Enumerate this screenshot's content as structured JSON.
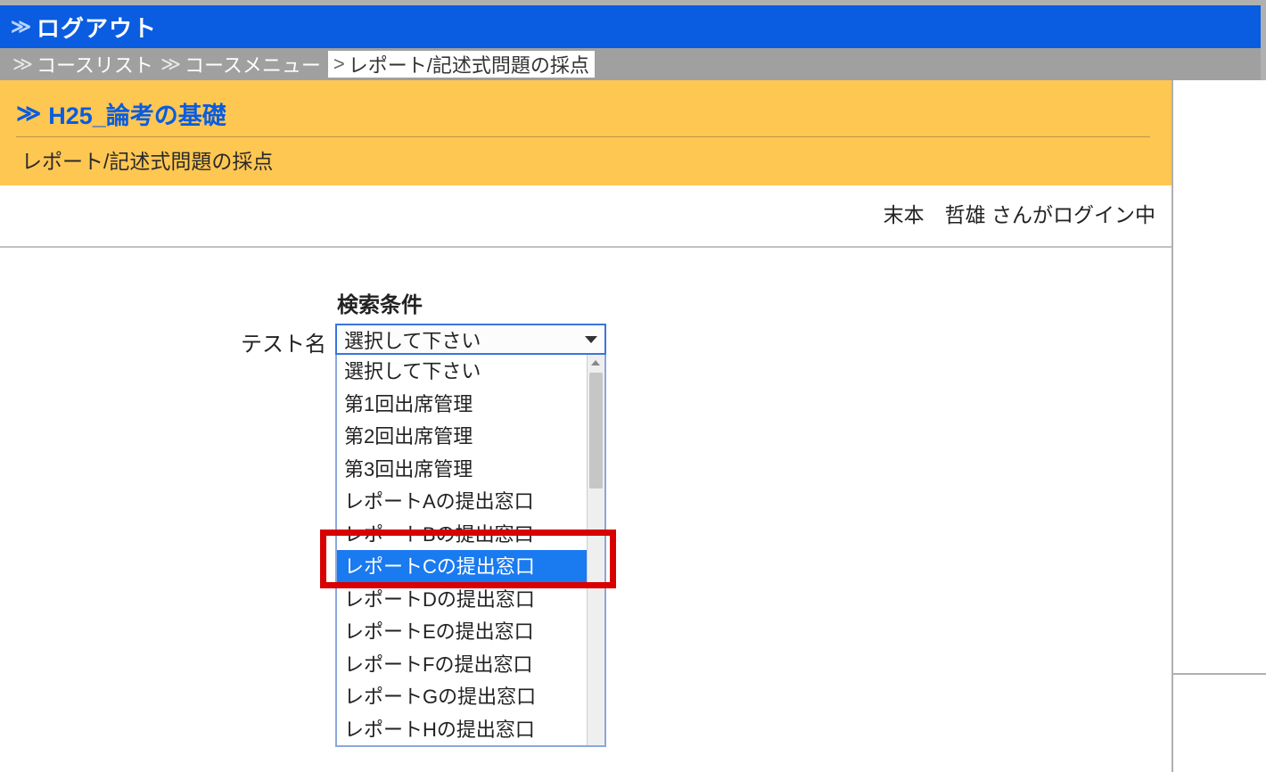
{
  "topbar": {
    "logout_label": "ログアウト"
  },
  "breadcrumb": {
    "items": [
      {
        "label": "コースリスト",
        "sep": "≫",
        "active": false
      },
      {
        "label": "コースメニュー",
        "sep": "≫",
        "active": false
      },
      {
        "label": "レポート/記述式問題の採点",
        "sep": ">",
        "active": true
      }
    ]
  },
  "course": {
    "title": "H25_論考の基礎",
    "subtitle": "レポート/記述式問題の採点"
  },
  "login_status": "末本　哲雄 さんがログイン中",
  "search": {
    "heading": "検索条件",
    "label": "テスト名",
    "selected": "選択して下さい",
    "options": [
      "選択して下さい",
      "第1回出席管理",
      "第2回出席管理",
      "第3回出席管理",
      "レポートAの提出窓口",
      "レポートBの提出窓口",
      "レポートCの提出窓口",
      "レポートDの提出窓口",
      "レポートEの提出窓口",
      "レポートFの提出窓口",
      "レポートGの提出窓口",
      "レポートHの提出窓口"
    ],
    "highlighted_index": 6
  }
}
